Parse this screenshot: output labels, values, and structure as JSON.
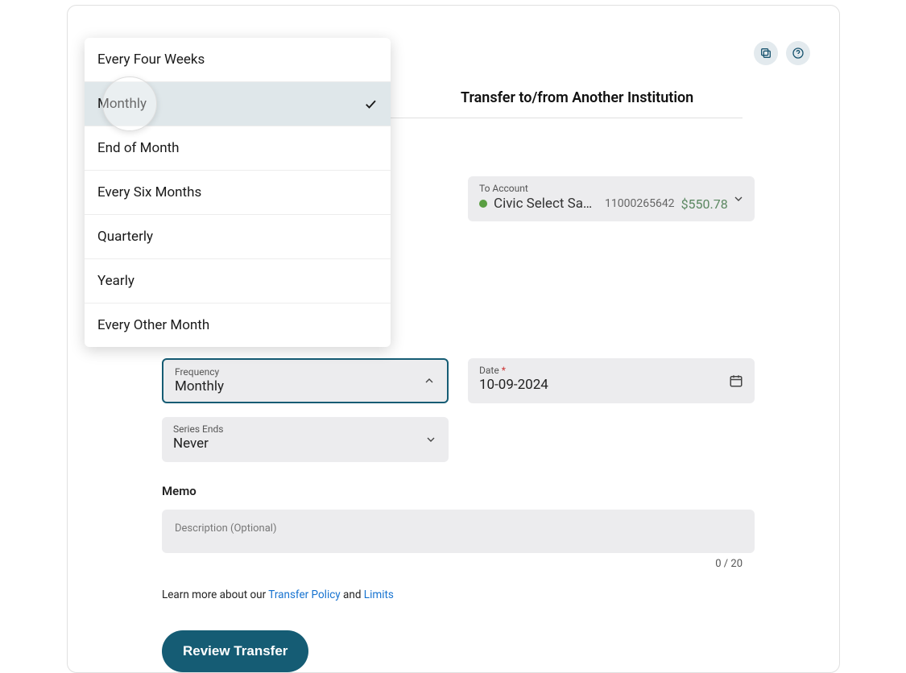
{
  "tabs": {
    "transfer_external": "Transfer to/from Another Institution"
  },
  "to_account": {
    "label": "To Account",
    "name": "Civic Select Savi…",
    "number": "11000265642",
    "balance": "$550.78"
  },
  "frequency": {
    "label": "Frequency",
    "value": "Monthly",
    "options": [
      "Every Four Weeks",
      "Monthly",
      "End of Month",
      "Every Six Months",
      "Quarterly",
      "Yearly",
      "Every Other Month"
    ],
    "selected_index": 1
  },
  "date": {
    "label": "Date",
    "required": "*",
    "value": "10-09-2024"
  },
  "series_ends": {
    "label": "Series Ends",
    "value": "Never"
  },
  "memo": {
    "section_label": "Memo",
    "placeholder": "Description (Optional)",
    "counter": "0 / 20"
  },
  "learn": {
    "prefix": "Learn more about our ",
    "policy": "Transfer Policy",
    "and": " and ",
    "limits": "Limits"
  },
  "buttons": {
    "review": "Review Transfer"
  },
  "icons": {
    "copy": "copy-icon",
    "help": "help-icon"
  }
}
